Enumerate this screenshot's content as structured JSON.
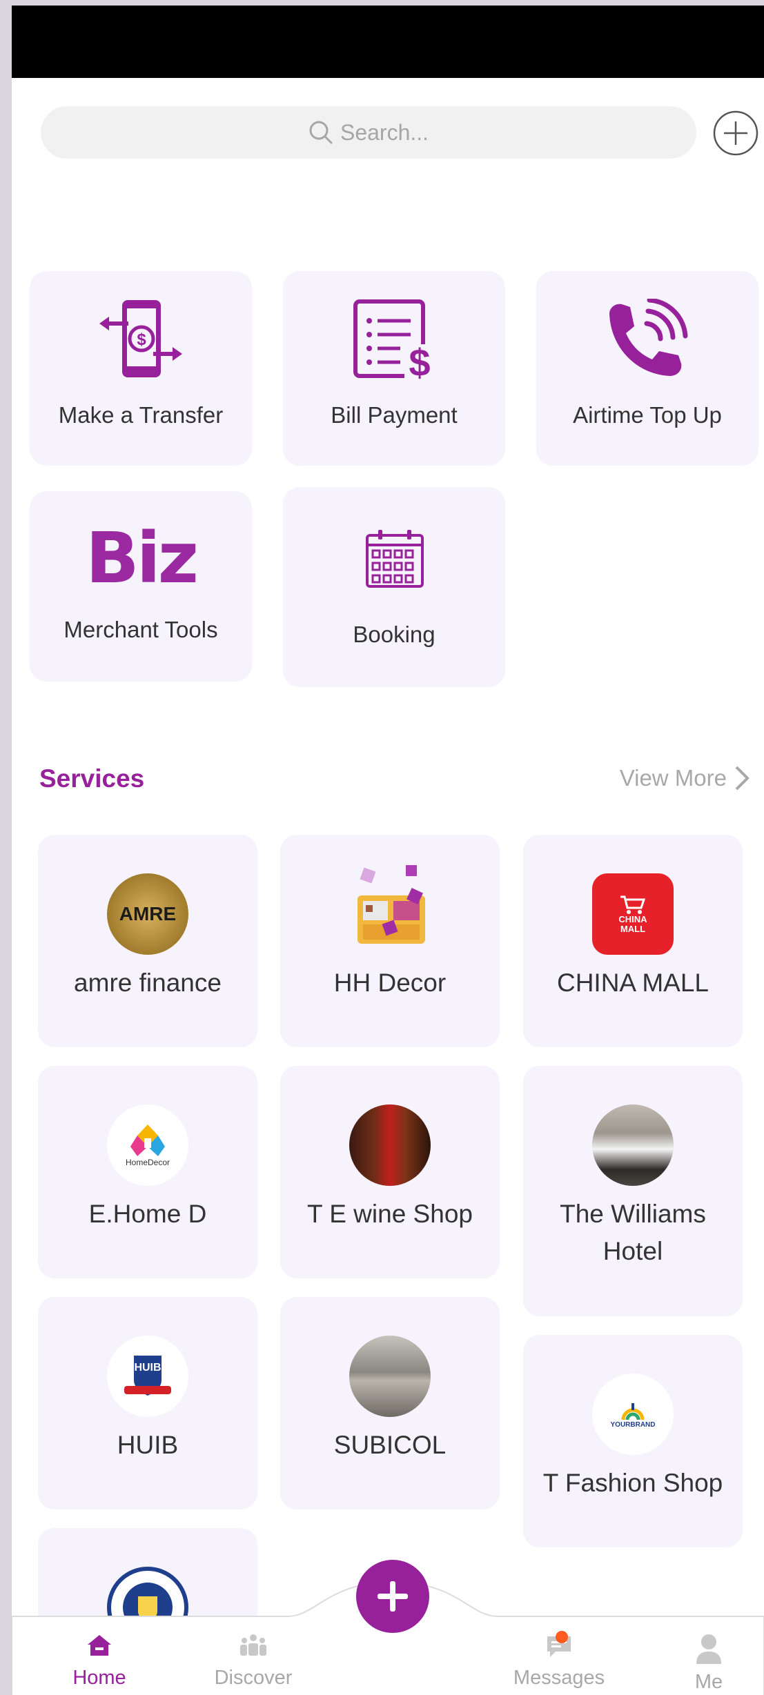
{
  "search": {
    "placeholder": "Search..."
  },
  "quick_actions": [
    {
      "label": "Make a Transfer",
      "icon": "phone-transfer-icon"
    },
    {
      "label": "Bill Payment",
      "icon": "bill-icon"
    },
    {
      "label": "Airtime Top Up",
      "icon": "phone-call-icon"
    },
    {
      "label": "Merchant Tools",
      "logo_text": "Biz"
    },
    {
      "label": "Booking",
      "icon": "calendar-icon"
    }
  ],
  "services": {
    "title": "Services",
    "view_more": "View More",
    "items": [
      {
        "name": "amre finance",
        "logo_text": "AMRE"
      },
      {
        "name": "HH Decor"
      },
      {
        "name": "CHINA MALL",
        "logo_text": "CHINA MALL"
      },
      {
        "name": "E.Home D",
        "logo_text": "HomeDecor"
      },
      {
        "name": "T E wine Shop"
      },
      {
        "name": "The Williams Hotel"
      },
      {
        "name": "HUIB",
        "logo_text": "HUIB"
      },
      {
        "name": "SUBICOL"
      },
      {
        "name": "T Fashion Shop",
        "logo_text": "YOURBRAND"
      }
    ]
  },
  "tabbar": {
    "home": "Home",
    "discover": "Discover",
    "messages": "Messages",
    "me": "Me"
  },
  "colors": {
    "accent": "#97209b",
    "card_bg": "#f6f3fd",
    "badge": "#ff5a1f"
  }
}
